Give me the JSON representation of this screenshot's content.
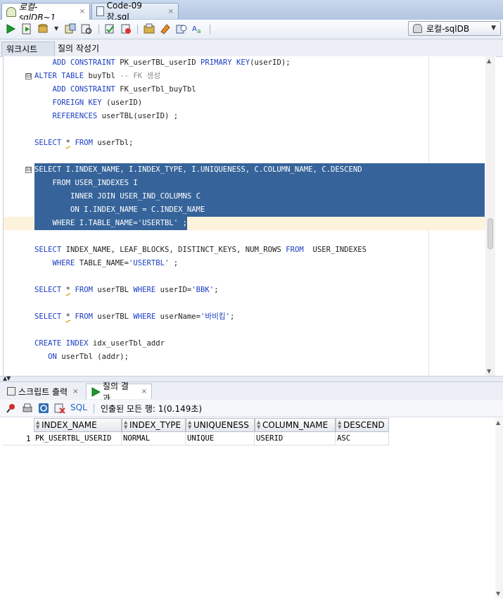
{
  "tabs": [
    {
      "label": "로컬-sqlDB~1",
      "active": true,
      "close": "×"
    },
    {
      "label": "Code-09장.sql",
      "active": false,
      "close": "×"
    }
  ],
  "toolbar": {
    "connection": "로컬-sqlDB",
    "icons": [
      "run-statement-icon",
      "run-script-icon",
      "commit-icon",
      "rollback-icon",
      "autotrace-icon",
      "explain-plan-icon",
      "sql-tuning-icon",
      "unshared-worksheet-icon",
      "clear-icon",
      "history-icon",
      "format-icon"
    ]
  },
  "subtabs": {
    "worksheet": "워크시트",
    "query_builder": "질의 작성기"
  },
  "editor": {
    "lines": [
      {
        "fold": "",
        "sel": "",
        "segs": [
          {
            "t": "    "
          },
          {
            "t": "ADD CONSTRAINT",
            "c": "kw"
          },
          {
            "t": " PK_userTBL_userID "
          },
          {
            "t": "PRIMARY KEY",
            "c": "kw"
          },
          {
            "t": "(userID);"
          }
        ]
      },
      {
        "fold": "⊟",
        "sel": "",
        "segs": [
          {
            "t": "ALTER TABLE",
            "c": "kw"
          },
          {
            "t": " buyTbl "
          },
          {
            "t": "-- FK 생성",
            "c": "cmt"
          }
        ]
      },
      {
        "fold": "",
        "sel": "",
        "segs": [
          {
            "t": "    "
          },
          {
            "t": "ADD CONSTRAINT",
            "c": "kw"
          },
          {
            "t": " FK_userTbl_buyTbl"
          }
        ]
      },
      {
        "fold": "",
        "sel": "",
        "segs": [
          {
            "t": "    "
          },
          {
            "t": "FOREIGN KEY",
            "c": "kw"
          },
          {
            "t": " (userID)"
          }
        ]
      },
      {
        "fold": "",
        "sel": "",
        "segs": [
          {
            "t": "    "
          },
          {
            "t": "REFERENCES",
            "c": "kw"
          },
          {
            "t": " userTBL(userID) ;"
          }
        ]
      },
      {
        "fold": "",
        "sel": "",
        "segs": [
          {
            "t": ""
          }
        ]
      },
      {
        "fold": "",
        "sel": "",
        "segs": [
          {
            "t": "SELECT",
            "c": "kw"
          },
          {
            "t": " "
          },
          {
            "t": "*",
            "c": "squig"
          },
          {
            "t": " "
          },
          {
            "t": "FROM",
            "c": "kw"
          },
          {
            "t": " userTbl;"
          }
        ]
      },
      {
        "fold": "",
        "sel": "",
        "segs": [
          {
            "t": ""
          }
        ]
      },
      {
        "fold": "⊟",
        "sel": "full",
        "segs": [
          {
            "t": "SELECT",
            "c": "kw"
          },
          {
            "t": " I.INDEX_NAME, I.INDEX_TYPE, I.UNIQUENESS, C.COLUMN_NAME, C.DESCEND"
          }
        ]
      },
      {
        "fold": "",
        "sel": "full",
        "segs": [
          {
            "t": "    "
          },
          {
            "t": "FROM",
            "c": "kw"
          },
          {
            "t": " USER_INDEXES I"
          }
        ]
      },
      {
        "fold": "",
        "sel": "full",
        "segs": [
          {
            "t": "        "
          },
          {
            "t": "INNER JOIN",
            "c": "kw"
          },
          {
            "t": " USER_IND_COLUMNS C"
          }
        ]
      },
      {
        "fold": "",
        "sel": "full",
        "segs": [
          {
            "t": "        "
          },
          {
            "t": "ON",
            "c": "kw"
          },
          {
            "t": " I.INDEX_NAME = C.INDEX_NAME"
          }
        ]
      },
      {
        "fold": "",
        "sel": "part",
        "segs": [
          {
            "t": "    "
          },
          {
            "t": "WHERE",
            "c": "kw"
          },
          {
            "t": " I.TABLE_NAME="
          },
          {
            "t": "'USERTBL'",
            "c": "str"
          },
          {
            "t": " ;"
          }
        ]
      },
      {
        "fold": "",
        "sel": "",
        "segs": [
          {
            "t": ""
          }
        ]
      },
      {
        "fold": "",
        "sel": "",
        "segs": [
          {
            "t": "SELECT",
            "c": "kw"
          },
          {
            "t": " INDEX_NAME, LEAF_BLOCKS, DISTINCT_KEYS, NUM_ROWS "
          },
          {
            "t": "FROM",
            "c": "kw"
          },
          {
            "t": "  USER_INDEXES"
          }
        ]
      },
      {
        "fold": "",
        "sel": "",
        "segs": [
          {
            "t": "    "
          },
          {
            "t": "WHERE",
            "c": "kw"
          },
          {
            "t": " TABLE_NAME="
          },
          {
            "t": "'USERTBL'",
            "c": "str"
          },
          {
            "t": " ;"
          }
        ]
      },
      {
        "fold": "",
        "sel": "",
        "segs": [
          {
            "t": ""
          }
        ]
      },
      {
        "fold": "",
        "sel": "",
        "segs": [
          {
            "t": "SELECT",
            "c": "kw"
          },
          {
            "t": " "
          },
          {
            "t": "*",
            "c": "squig"
          },
          {
            "t": " "
          },
          {
            "t": "FROM",
            "c": "kw"
          },
          {
            "t": " userTBL "
          },
          {
            "t": "WHERE",
            "c": "kw"
          },
          {
            "t": " userID="
          },
          {
            "t": "'BBK'",
            "c": "str"
          },
          {
            "t": ";"
          }
        ]
      },
      {
        "fold": "",
        "sel": "",
        "segs": [
          {
            "t": ""
          }
        ]
      },
      {
        "fold": "",
        "sel": "",
        "segs": [
          {
            "t": "SELECT",
            "c": "kw"
          },
          {
            "t": " "
          },
          {
            "t": "*",
            "c": "squig"
          },
          {
            "t": " "
          },
          {
            "t": "FROM",
            "c": "kw"
          },
          {
            "t": " userTBL "
          },
          {
            "t": "WHERE",
            "c": "kw"
          },
          {
            "t": " userName="
          },
          {
            "t": "'바비킴'",
            "c": "str"
          },
          {
            "t": ";"
          }
        ]
      },
      {
        "fold": "",
        "sel": "",
        "segs": [
          {
            "t": ""
          }
        ]
      },
      {
        "fold": "",
        "sel": "",
        "segs": [
          {
            "t": "CREATE INDEX",
            "c": "kw"
          },
          {
            "t": " idx_userTbl_addr"
          }
        ]
      },
      {
        "fold": "",
        "sel": "",
        "segs": [
          {
            "t": "   "
          },
          {
            "t": "ON",
            "c": "kw"
          },
          {
            "t": " userTbl (addr);"
          }
        ]
      }
    ]
  },
  "result_tabs": [
    {
      "label": "스크립트 출력",
      "active": false,
      "close": "×"
    },
    {
      "label": "질의 결과",
      "active": true,
      "close": "×"
    }
  ],
  "result_toolbar": {
    "sql": "SQL",
    "status": "인출된 모든 행: 1(0.149초)"
  },
  "grid": {
    "columns": [
      "INDEX_NAME",
      "INDEX_TYPE",
      "UNIQUENESS",
      "COLUMN_NAME",
      "DESCEND"
    ],
    "rows": [
      {
        "num": "1",
        "cells": [
          "PK_USERTBL_USERID",
          "NORMAL",
          "UNIQUE",
          "USERID",
          "ASC"
        ]
      }
    ]
  },
  "colors": {
    "selection": "#36649a",
    "keyword": "#1b3ec2",
    "current_line": "#fdf3dc",
    "link": "#1e66c8"
  }
}
